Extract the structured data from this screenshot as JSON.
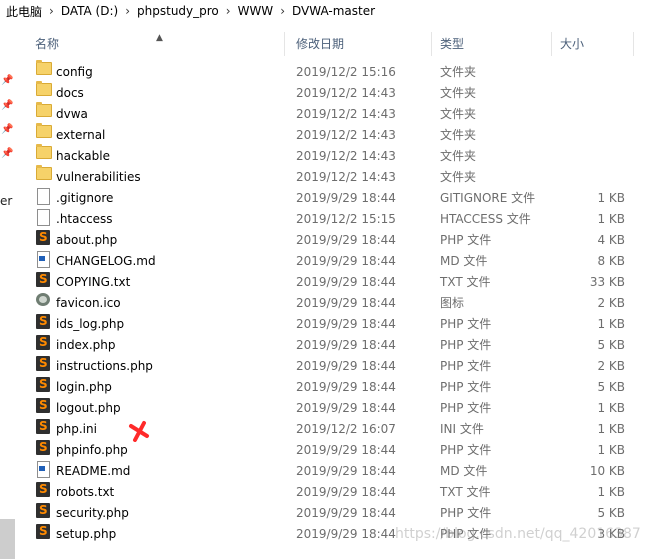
{
  "breadcrumb": [
    "此电脑",
    "DATA (D:)",
    "phpstudy_pro",
    "WWW",
    "DVWA-master"
  ],
  "left_pane_text": "er",
  "columns": {
    "name": "名称",
    "modified": "修改日期",
    "type": "类型",
    "size": "大小"
  },
  "files": [
    {
      "name": "config",
      "date": "2019/12/2 15:16",
      "type": "文件夹",
      "size": "",
      "icon": "folder-icon"
    },
    {
      "name": "docs",
      "date": "2019/12/2 14:43",
      "type": "文件夹",
      "size": "",
      "icon": "folder-icon"
    },
    {
      "name": "dvwa",
      "date": "2019/12/2 14:43",
      "type": "文件夹",
      "size": "",
      "icon": "folder-icon"
    },
    {
      "name": "external",
      "date": "2019/12/2 14:43",
      "type": "文件夹",
      "size": "",
      "icon": "folder-icon"
    },
    {
      "name": "hackable",
      "date": "2019/12/2 14:43",
      "type": "文件夹",
      "size": "",
      "icon": "folder-icon"
    },
    {
      "name": "vulnerabilities",
      "date": "2019/12/2 14:43",
      "type": "文件夹",
      "size": "",
      "icon": "folder-icon"
    },
    {
      "name": ".gitignore",
      "date": "2019/9/29 18:44",
      "type": "GITIGNORE 文件",
      "size": "1 KB",
      "icon": "file-icon"
    },
    {
      "name": ".htaccess",
      "date": "2019/12/2 15:15",
      "type": "HTACCESS 文件",
      "size": "1 KB",
      "icon": "file-icon"
    },
    {
      "name": "about.php",
      "date": "2019/9/29 18:44",
      "type": "PHP 文件",
      "size": "4 KB",
      "icon": "php-file-icon"
    },
    {
      "name": "CHANGELOG.md",
      "date": "2019/9/29 18:44",
      "type": "MD 文件",
      "size": "8 KB",
      "icon": "md-file-icon"
    },
    {
      "name": "COPYING.txt",
      "date": "2019/9/29 18:44",
      "type": "TXT 文件",
      "size": "33 KB",
      "icon": "php-file-icon"
    },
    {
      "name": "favicon.ico",
      "date": "2019/9/29 18:44",
      "type": "图标",
      "size": "2 KB",
      "icon": "ico-file-icon"
    },
    {
      "name": "ids_log.php",
      "date": "2019/9/29 18:44",
      "type": "PHP 文件",
      "size": "1 KB",
      "icon": "php-file-icon"
    },
    {
      "name": "index.php",
      "date": "2019/9/29 18:44",
      "type": "PHP 文件",
      "size": "5 KB",
      "icon": "php-file-icon"
    },
    {
      "name": "instructions.php",
      "date": "2019/9/29 18:44",
      "type": "PHP 文件",
      "size": "2 KB",
      "icon": "php-file-icon"
    },
    {
      "name": "login.php",
      "date": "2019/9/29 18:44",
      "type": "PHP 文件",
      "size": "5 KB",
      "icon": "php-file-icon"
    },
    {
      "name": "logout.php",
      "date": "2019/9/29 18:44",
      "type": "PHP 文件",
      "size": "1 KB",
      "icon": "php-file-icon"
    },
    {
      "name": "php.ini",
      "date": "2019/12/2 16:07",
      "type": "INI 文件",
      "size": "1 KB",
      "icon": "php-file-icon"
    },
    {
      "name": "phpinfo.php",
      "date": "2019/9/29 18:44",
      "type": "PHP 文件",
      "size": "1 KB",
      "icon": "php-file-icon"
    },
    {
      "name": "README.md",
      "date": "2019/9/29 18:44",
      "type": "MD 文件",
      "size": "10 KB",
      "icon": "md-file-icon"
    },
    {
      "name": "robots.txt",
      "date": "2019/9/29 18:44",
      "type": "TXT 文件",
      "size": "1 KB",
      "icon": "php-file-icon"
    },
    {
      "name": "security.php",
      "date": "2019/9/29 18:44",
      "type": "PHP 文件",
      "size": "5 KB",
      "icon": "php-file-icon"
    },
    {
      "name": "setup.php",
      "date": "2019/9/29 18:44",
      "type": "PHP 文件",
      "size": "3 KB",
      "icon": "php-file-icon"
    }
  ],
  "watermark": "https://blog.csdn.net/qq_42016387",
  "colors": {
    "folder": "#f6d269",
    "header_text": "#4c607a",
    "annotation": "#ff2a2a"
  }
}
